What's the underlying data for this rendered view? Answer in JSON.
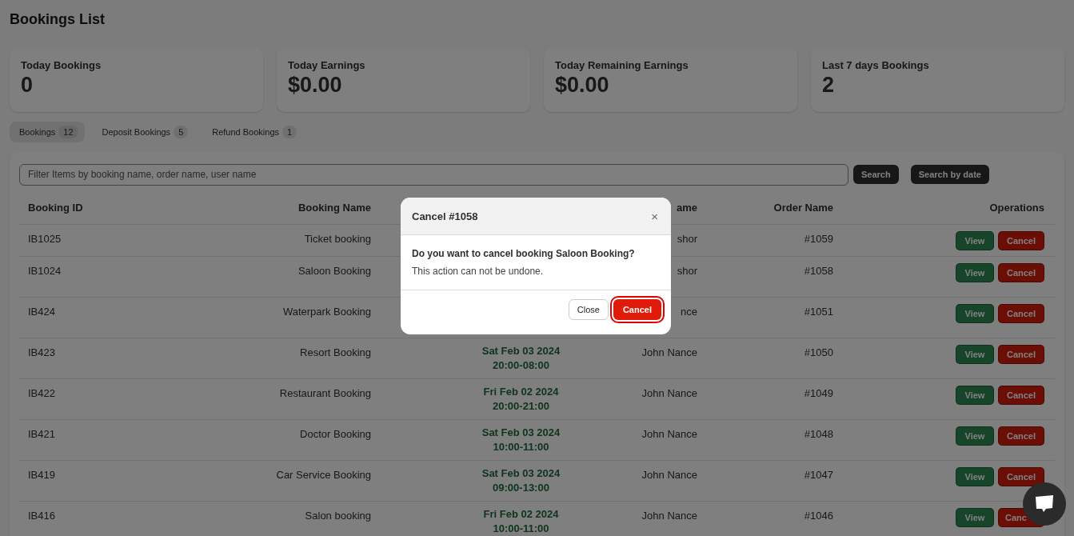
{
  "page_title": "Bookings List",
  "stats": [
    {
      "label": "Today Bookings",
      "value": "0"
    },
    {
      "label": "Today Earnings",
      "value": "$0.00"
    },
    {
      "label": "Today Remaining Earnings",
      "value": "$0.00"
    },
    {
      "label": "Last 7 days Bookings",
      "value": "2"
    }
  ],
  "tabs": [
    {
      "label": "Bookings",
      "count": "12",
      "selected": true
    },
    {
      "label": "Deposit Bookings",
      "count": "5",
      "selected": false
    },
    {
      "label": "Refund Bookings",
      "count": "1",
      "selected": false
    }
  ],
  "search": {
    "placeholder": "Filter Items by booking name, order name, user name",
    "buttons": [
      "Search",
      "Search by date"
    ]
  },
  "table": {
    "columns": [
      "Booking ID",
      "Booking Name",
      "",
      "ame",
      "Order Name",
      "Operations"
    ],
    "rows": [
      {
        "id": "IB1025",
        "name": "Ticket booking",
        "user": "shor",
        "order": "#1059",
        "actions": [
          "View",
          "Cancel"
        ]
      },
      {
        "id": "IB1024",
        "name": "Saloon Booking",
        "user": "shor",
        "order": "#1058",
        "actions": [
          "View",
          "Cancel"
        ]
      },
      {
        "id": "IB424",
        "name": "Waterpark Booking",
        "user": "nce",
        "order": "#1051",
        "actions": [
          "View",
          "Cancel"
        ]
      },
      {
        "id": "IB423",
        "name": "Resort Booking",
        "date": "Sat Feb 03 2024",
        "time": "20:00-08:00",
        "user": "John Nance",
        "order": "#1050",
        "actions": [
          "View",
          "Cancel"
        ]
      },
      {
        "id": "IB422",
        "name": "Restaurant Booking",
        "date": "Fri Feb 02 2024",
        "time": "20:00-21:00",
        "user": "John Nance",
        "order": "#1049",
        "actions": [
          "View",
          "Cancel"
        ]
      },
      {
        "id": "IB421",
        "name": "Doctor Booking",
        "date": "Sat Feb 03 2024",
        "time": "10:00-11:00",
        "user": "John Nance",
        "order": "#1048",
        "actions": [
          "View",
          "Cancel"
        ]
      },
      {
        "id": "IB419",
        "name": "Car Service Booking",
        "date": "Sat Feb 03 2024",
        "time": "09:00-13:00",
        "user": "John Nance",
        "order": "#1047",
        "actions": [
          "View",
          "Cancel"
        ]
      },
      {
        "id": "IB416",
        "name": "Salon booking",
        "date": "Fri Feb 02 2024",
        "time": "10:00-11:00",
        "user": "John Nance",
        "order": "#1046",
        "actions": [
          "View",
          "Canc"
        ],
        "partly_hidden": true
      }
    ]
  },
  "modal": {
    "title": "Cancel #1058",
    "close_symbol": "×",
    "question": "Do you want to cancel booking Saloon Booking?",
    "note": "This action can not be undone.",
    "buttons": [
      "Close",
      "Cancel"
    ]
  }
}
